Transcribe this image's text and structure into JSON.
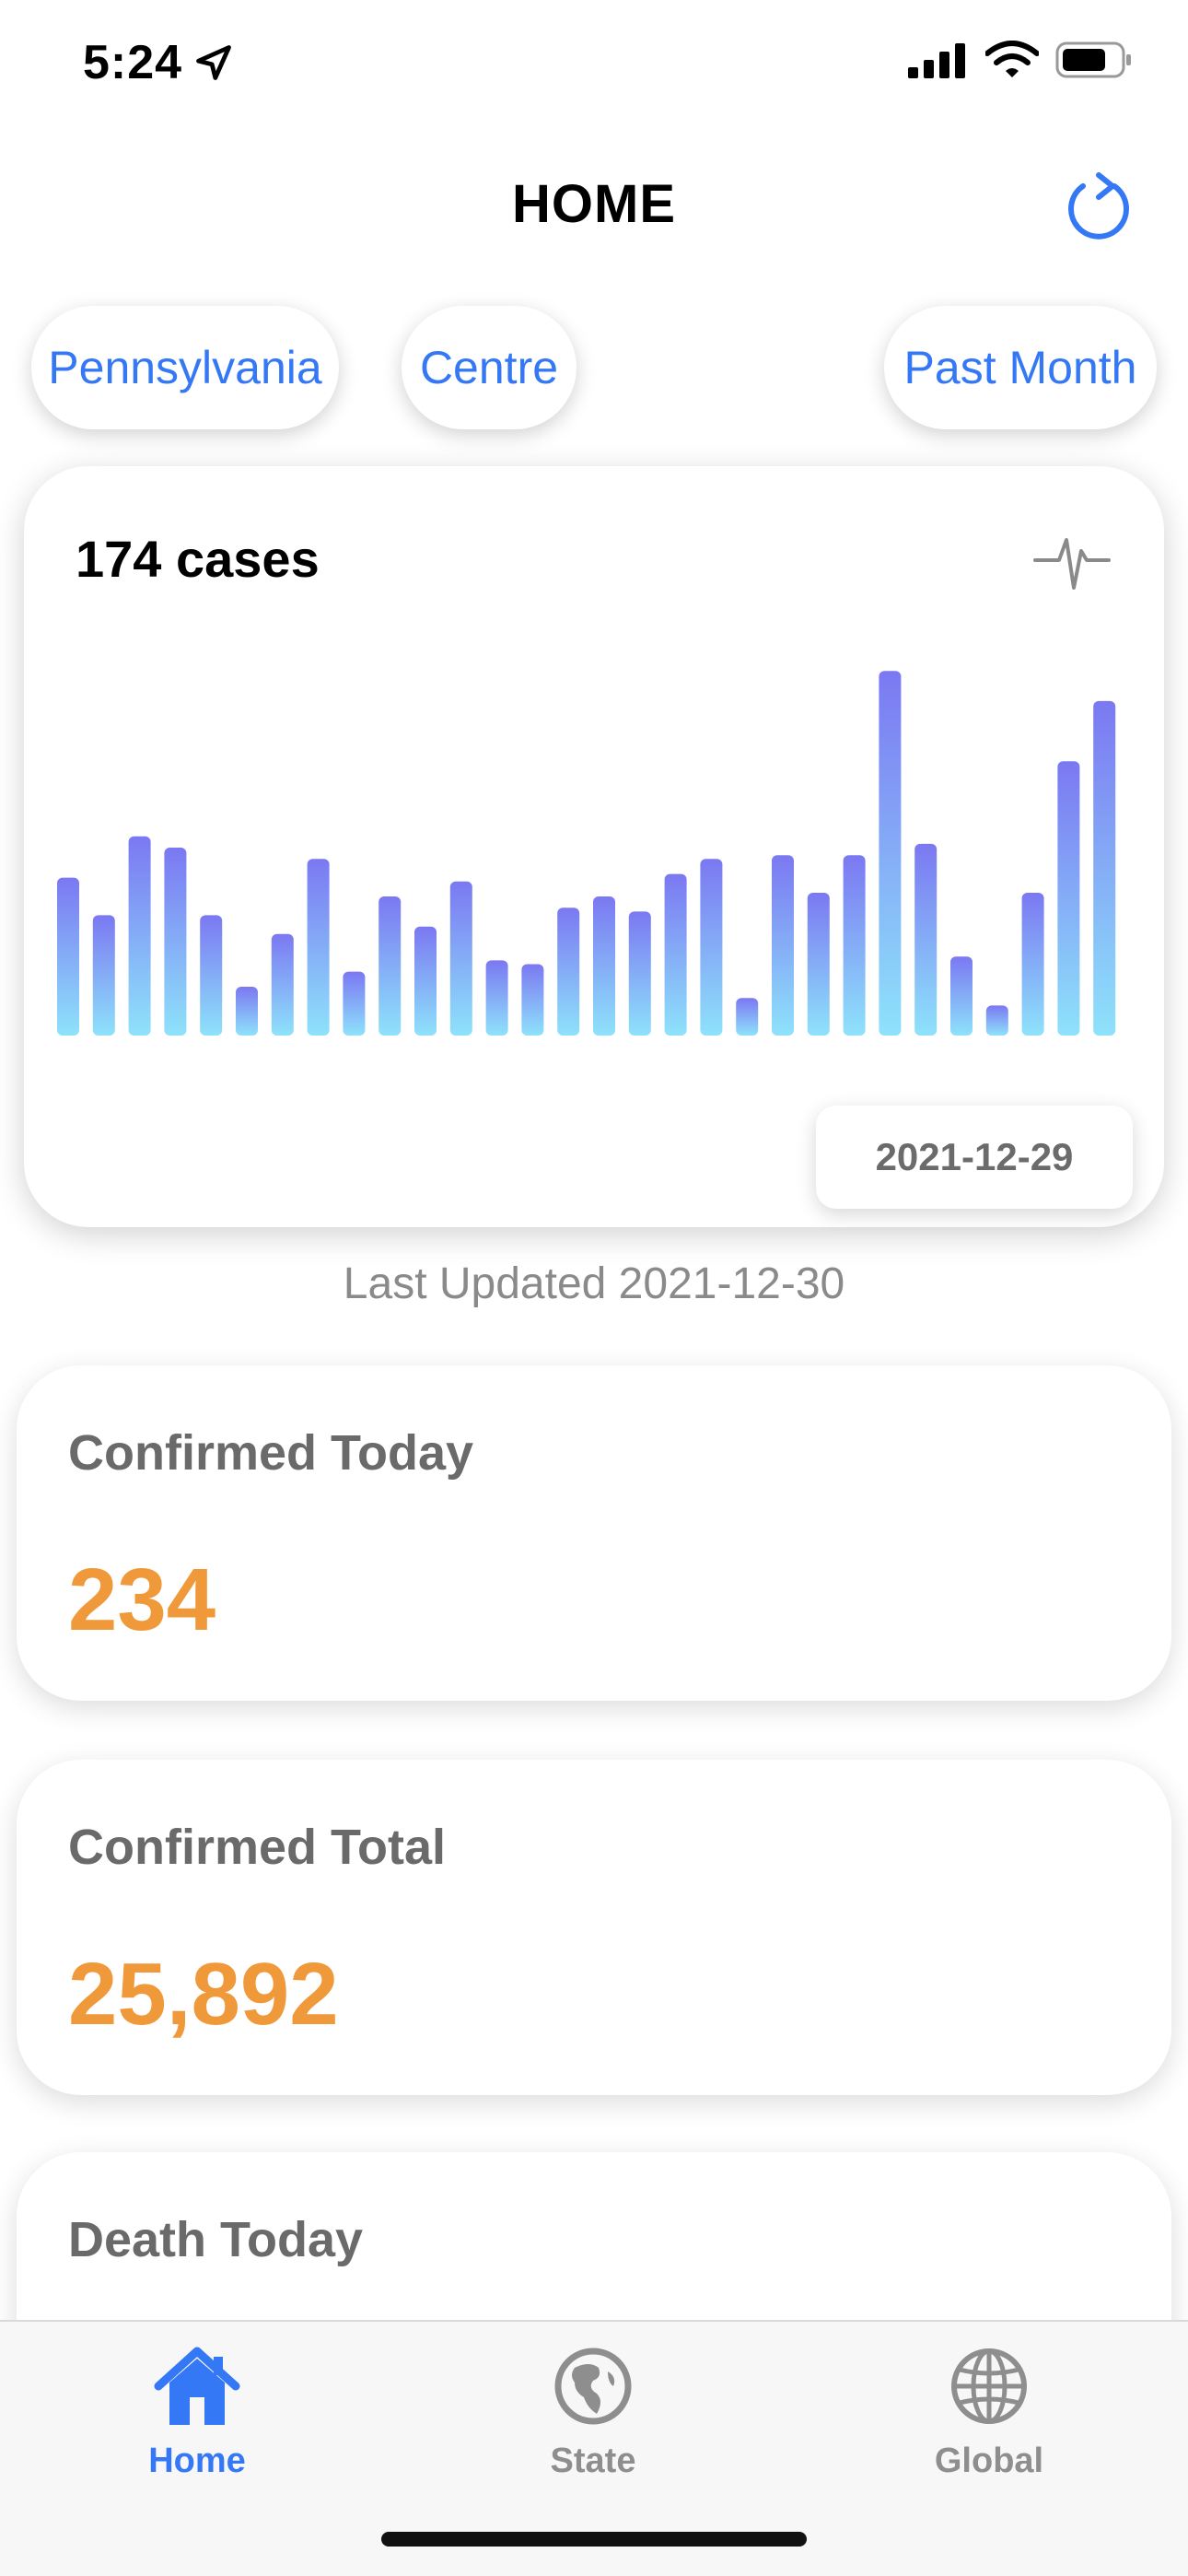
{
  "status_bar": {
    "time": "5:24"
  },
  "nav": {
    "title": "HOME"
  },
  "filters": {
    "state": "Pennsylvania",
    "county": "Centre",
    "period": "Past Month"
  },
  "chart_card": {
    "headline": "174 cases",
    "tooltip_date": "2021-12-29"
  },
  "chart_data": {
    "type": "bar",
    "bar_values": [
      42,
      32,
      53,
      50,
      32,
      13,
      27,
      47,
      17,
      37,
      29,
      41,
      20,
      19,
      34,
      37,
      33,
      43,
      47,
      10,
      48,
      38,
      48,
      97,
      51,
      21,
      8,
      38,
      73,
      89
    ],
    "gradient_top": "#7b78f2",
    "gradient_bottom": "#8ee2fb",
    "selected_index": 29,
    "ylim": [
      0,
      100
    ]
  },
  "last_updated": "Last Updated 2021-12-30",
  "stats": [
    {
      "label": "Confirmed Today",
      "value": "234"
    },
    {
      "label": "Confirmed Total",
      "value": "25,892"
    },
    {
      "label": "Death Today",
      "value": ""
    }
  ],
  "tabs": [
    {
      "label": "Home",
      "icon": "house-icon",
      "active": true
    },
    {
      "label": "State",
      "icon": "globe-americas-icon",
      "active": false
    },
    {
      "label": "Global",
      "icon": "globe-icon",
      "active": false
    }
  ],
  "colors": {
    "accent": "#3478f6",
    "stat_value": "#f0993a"
  }
}
